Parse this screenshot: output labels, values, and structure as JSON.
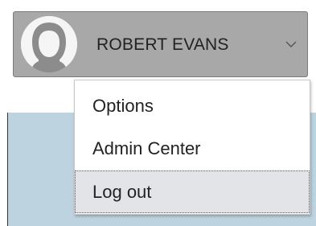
{
  "user_menu": {
    "user_name": "ROBERT EVANS",
    "avatar_icon": "user-avatar-icon",
    "chevron_icon": "chevron-down-icon",
    "button_color": "#a8a8a8"
  },
  "dropdown": {
    "items": [
      {
        "label": "Options"
      },
      {
        "label": "Admin Center"
      },
      {
        "label": "Log out",
        "focused": true
      }
    ],
    "focus_color": "#e3e4e7"
  },
  "page": {
    "band_color": "#bdd3df"
  }
}
